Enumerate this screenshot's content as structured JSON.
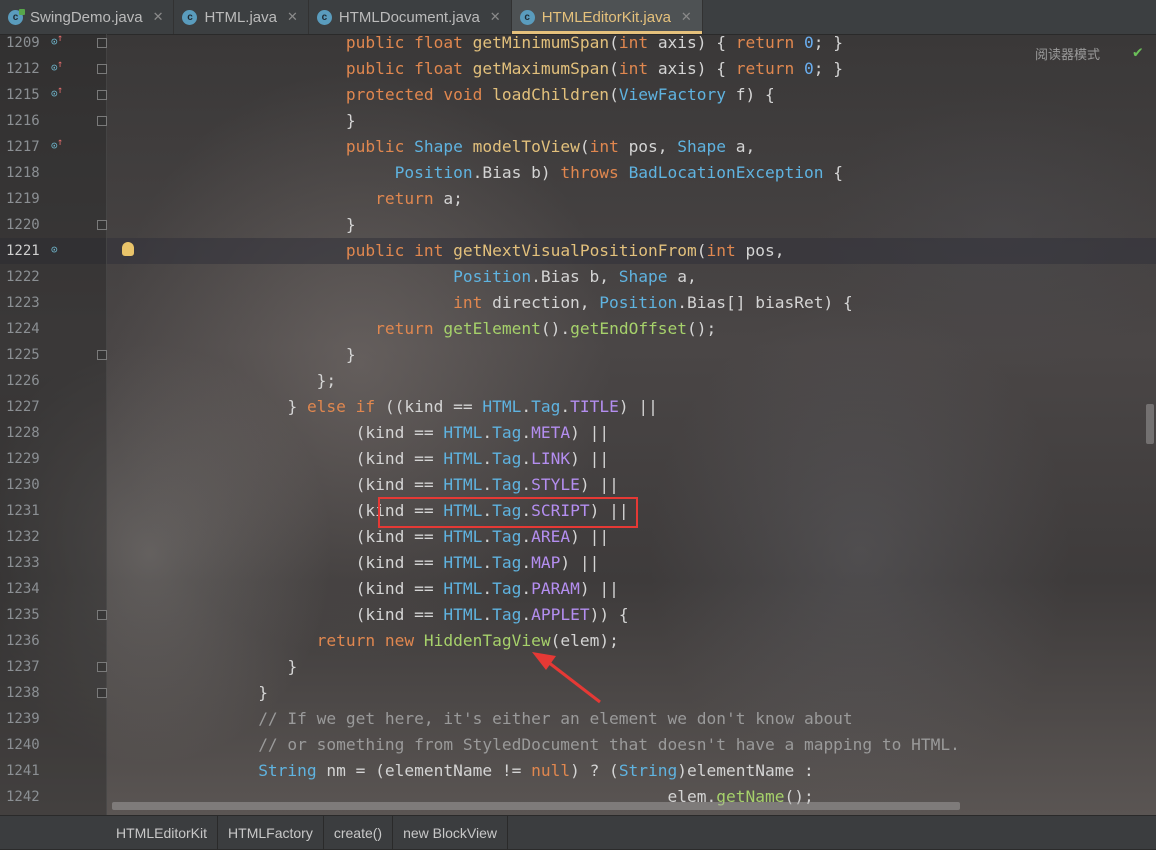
{
  "tabs": [
    {
      "label": "SwingDemo.java",
      "icon": "run-class-icon",
      "active": false
    },
    {
      "label": "HTML.java",
      "icon": "class-icon",
      "active": false
    },
    {
      "label": "HTMLDocument.java",
      "icon": "class-icon",
      "active": false
    },
    {
      "label": "HTMLEditorKit.java",
      "icon": "class-icon",
      "active": true
    }
  ],
  "tab_icon_letter": "c",
  "reader_mode": "阅读器模式",
  "line_numbers": [
    "1209",
    "1212",
    "1215",
    "1216",
    "1217",
    "1218",
    "1219",
    "1220",
    "1221",
    "1222",
    "1223",
    "1224",
    "1225",
    "1226",
    "1227",
    "1228",
    "1229",
    "1230",
    "1231",
    "1232",
    "1233",
    "1234",
    "1235",
    "1236",
    "1237",
    "1238",
    "1239",
    "1240",
    "1241",
    "1242"
  ],
  "current_line": "1221",
  "code_lines": [
    {
      "indent": "                        ",
      "tokens": [
        [
          "kw",
          "public "
        ],
        [
          "kw",
          "float "
        ],
        [
          "fn",
          "getMinimumSpan"
        ],
        [
          "",
          "("
        ],
        [
          "kw",
          "int "
        ],
        [
          "",
          "axis) { "
        ],
        [
          "kw",
          "return "
        ],
        [
          "num",
          "0"
        ],
        [
          "",
          ";"
        ],
        [
          "",
          " }"
        ]
      ]
    },
    {
      "indent": "                        ",
      "tokens": [
        [
          "kw",
          "public "
        ],
        [
          "kw",
          "float "
        ],
        [
          "fn",
          "getMaximumSpan"
        ],
        [
          "",
          "("
        ],
        [
          "kw",
          "int "
        ],
        [
          "",
          "axis) { "
        ],
        [
          "kw",
          "return "
        ],
        [
          "num",
          "0"
        ],
        [
          "",
          ";"
        ],
        [
          "",
          " }"
        ]
      ]
    },
    {
      "indent": "                        ",
      "tokens": [
        [
          "kw",
          "protected "
        ],
        [
          "kw",
          "void "
        ],
        [
          "fn",
          "loadChildren"
        ],
        [
          "",
          "("
        ],
        [
          "ty",
          "ViewFactory "
        ],
        [
          "",
          "f) {"
        ]
      ]
    },
    {
      "indent": "                        ",
      "tokens": [
        [
          "",
          "}"
        ]
      ]
    },
    {
      "indent": "                        ",
      "tokens": [
        [
          "kw",
          "public "
        ],
        [
          "ty",
          "Shape "
        ],
        [
          "fn",
          "modelToView"
        ],
        [
          "",
          "("
        ],
        [
          "kw",
          "int "
        ],
        [
          "",
          "pos, "
        ],
        [
          "ty",
          "Shape "
        ],
        [
          "",
          "a,"
        ]
      ]
    },
    {
      "indent": "                             ",
      "tokens": [
        [
          "ty",
          "Position"
        ],
        [
          "",
          ".Bias b) "
        ],
        [
          "kw",
          "throws "
        ],
        [
          "ty",
          "BadLocationException "
        ],
        [
          "",
          "{"
        ]
      ]
    },
    {
      "indent": "                           ",
      "tokens": [
        [
          "kw",
          "return "
        ],
        [
          "",
          "a;"
        ]
      ]
    },
    {
      "indent": "                        ",
      "tokens": [
        [
          "",
          "}"
        ]
      ]
    },
    {
      "indent": "                        ",
      "tokens": [
        [
          "kw",
          "public "
        ],
        [
          "kw",
          "int "
        ],
        [
          "fn",
          "getNextVisualPositionFrom"
        ],
        [
          "",
          "("
        ],
        [
          "kw",
          "int "
        ],
        [
          "",
          "pos,"
        ]
      ]
    },
    {
      "indent": "                                   ",
      "tokens": [
        [
          "ty",
          "Position"
        ],
        [
          "",
          ".Bias b, "
        ],
        [
          "ty",
          "Shape "
        ],
        [
          "",
          "a,"
        ]
      ]
    },
    {
      "indent": "                                   ",
      "tokens": [
        [
          "kw",
          "int "
        ],
        [
          "",
          "direction, "
        ],
        [
          "ty",
          "Position"
        ],
        [
          "",
          ".Bias[] biasRet) {"
        ]
      ]
    },
    {
      "indent": "                           ",
      "tokens": [
        [
          "kw",
          "return "
        ],
        [
          "fg",
          "getElement"
        ],
        [
          "",
          "()."
        ],
        [
          "fg",
          "getEndOffset"
        ],
        [
          "",
          "();"
        ]
      ]
    },
    {
      "indent": "                        ",
      "tokens": [
        [
          "",
          "}"
        ]
      ]
    },
    {
      "indent": "                     ",
      "tokens": [
        [
          "",
          "};"
        ]
      ]
    },
    {
      "indent": "                  ",
      "tokens": [
        [
          "",
          "} "
        ],
        [
          "kw",
          "else if "
        ],
        [
          "",
          "((kind == "
        ],
        [
          "ty",
          "HTML"
        ],
        [
          "",
          "."
        ],
        [
          "ty",
          "Tag"
        ],
        [
          "",
          "."
        ],
        [
          "cst",
          "TITLE"
        ],
        [
          "",
          ") ||"
        ]
      ]
    },
    {
      "indent": "                         ",
      "tokens": [
        [
          "",
          "(kind == "
        ],
        [
          "ty",
          "HTML"
        ],
        [
          "",
          "."
        ],
        [
          "ty",
          "Tag"
        ],
        [
          "",
          "."
        ],
        [
          "cst",
          "META"
        ],
        [
          "",
          ") ||"
        ]
      ]
    },
    {
      "indent": "                         ",
      "tokens": [
        [
          "",
          "(kind == "
        ],
        [
          "ty",
          "HTML"
        ],
        [
          "",
          "."
        ],
        [
          "ty",
          "Tag"
        ],
        [
          "",
          "."
        ],
        [
          "cst",
          "LINK"
        ],
        [
          "",
          ") ||"
        ]
      ]
    },
    {
      "indent": "                         ",
      "tokens": [
        [
          "",
          "(kind == "
        ],
        [
          "ty",
          "HTML"
        ],
        [
          "",
          "."
        ],
        [
          "ty",
          "Tag"
        ],
        [
          "",
          "."
        ],
        [
          "cst",
          "STYLE"
        ],
        [
          "",
          ") ||"
        ]
      ]
    },
    {
      "indent": "                         ",
      "tokens": [
        [
          "",
          "(kind == "
        ],
        [
          "ty",
          "HTML"
        ],
        [
          "",
          "."
        ],
        [
          "ty",
          "Tag"
        ],
        [
          "",
          "."
        ],
        [
          "cst",
          "SCRIPT"
        ],
        [
          "",
          ") ||"
        ]
      ]
    },
    {
      "indent": "                         ",
      "tokens": [
        [
          "",
          "(kind == "
        ],
        [
          "ty",
          "HTML"
        ],
        [
          "",
          "."
        ],
        [
          "ty",
          "Tag"
        ],
        [
          "",
          "."
        ],
        [
          "cst",
          "AREA"
        ],
        [
          "",
          ") ||"
        ]
      ]
    },
    {
      "indent": "                         ",
      "tokens": [
        [
          "",
          "(kind == "
        ],
        [
          "ty",
          "HTML"
        ],
        [
          "",
          "."
        ],
        [
          "ty",
          "Tag"
        ],
        [
          "",
          "."
        ],
        [
          "cst",
          "MAP"
        ],
        [
          "",
          ") ||"
        ]
      ]
    },
    {
      "indent": "                         ",
      "tokens": [
        [
          "",
          "(kind == "
        ],
        [
          "ty",
          "HTML"
        ],
        [
          "",
          "."
        ],
        [
          "ty",
          "Tag"
        ],
        [
          "",
          "."
        ],
        [
          "cst",
          "PARAM"
        ],
        [
          "",
          ") ||"
        ]
      ]
    },
    {
      "indent": "                         ",
      "tokens": [
        [
          "",
          "(kind == "
        ],
        [
          "ty",
          "HTML"
        ],
        [
          "",
          "."
        ],
        [
          "ty",
          "Tag"
        ],
        [
          "",
          "."
        ],
        [
          "cst",
          "APPLET"
        ],
        [
          "",
          ")) {"
        ]
      ]
    },
    {
      "indent": "                     ",
      "tokens": [
        [
          "kw",
          "return "
        ],
        [
          "kw",
          "new "
        ],
        [
          "fg",
          "HiddenTagView"
        ],
        [
          "",
          "(elem);"
        ]
      ]
    },
    {
      "indent": "                  ",
      "tokens": [
        [
          "",
          "}"
        ]
      ]
    },
    {
      "indent": "               ",
      "tokens": [
        [
          "",
          "}"
        ]
      ]
    },
    {
      "indent": "               ",
      "tokens": [
        [
          "cm",
          "// If we get here, it's either an element we don't know about"
        ]
      ]
    },
    {
      "indent": "               ",
      "tokens": [
        [
          "cm",
          "// or something from StyledDocument that doesn't have a mapping to HTML."
        ]
      ]
    },
    {
      "indent": "               ",
      "tokens": [
        [
          "ty",
          "String "
        ],
        [
          "",
          "nm = (elementName != "
        ],
        [
          "kw",
          "null"
        ],
        [
          "",
          ") ? ("
        ],
        [
          "ty",
          "String"
        ],
        [
          "",
          ")elementName :"
        ]
      ]
    },
    {
      "indent": "                                                         ",
      "tokens": [
        [
          "",
          "elem."
        ],
        [
          "fg",
          "getName"
        ],
        [
          "",
          "();"
        ]
      ]
    }
  ],
  "breadcrumb": [
    "HTMLEditorKit",
    "HTMLFactory",
    "create()",
    "new BlockView"
  ],
  "colors": {
    "keyword": "#e0874f",
    "type": "#5fb3e0",
    "method": "#e2c07c",
    "call": "#a6d16b",
    "constant": "#b48ef0",
    "comment": "#9a9a9a",
    "highlight_box": "#e53935",
    "active_tab": "#e5c17c"
  }
}
